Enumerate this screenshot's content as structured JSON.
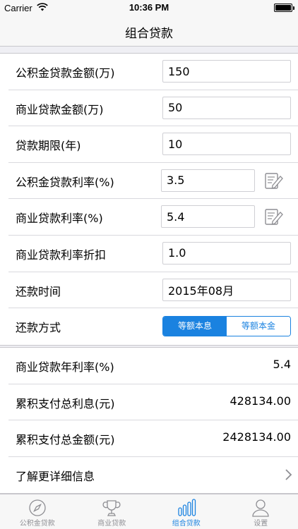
{
  "status_bar": {
    "carrier": "Carrier",
    "time": "10:36 PM"
  },
  "nav": {
    "title": "组合贷款"
  },
  "inputs": {
    "fund_amount": {
      "label": "公积金贷款金额(万)",
      "value": "150"
    },
    "commercial_amount": {
      "label": "商业贷款金额(万)",
      "value": "50"
    },
    "term": {
      "label": "贷款期限(年)",
      "value": "10"
    },
    "fund_rate": {
      "label": "公积金贷款利率(%)",
      "value": "3.5"
    },
    "commercial_rate": {
      "label": "商业贷款利率(%)",
      "value": "5.4"
    },
    "discount": {
      "label": "商业贷款利率折扣",
      "value": "1.0"
    },
    "start_date": {
      "label": "还款时间",
      "value": "2015年08月"
    },
    "method": {
      "label": "还款方式",
      "options": [
        "等额本息",
        "等额本金"
      ],
      "selected": "等额本息"
    }
  },
  "results": {
    "annual_rate": {
      "label": "商业贷款年利率(%)",
      "value": "5.4"
    },
    "total_interest": {
      "label": "累积支付总利息(元)",
      "value": "428134.00"
    },
    "total_payment": {
      "label": "累积支付总金额(元)",
      "value": "2428134.00"
    },
    "details": {
      "label": "了解更详细信息"
    }
  },
  "tabs": [
    {
      "label": "公积金贷款",
      "icon": "compass-icon",
      "active": false
    },
    {
      "label": "商业贷款",
      "icon": "trophy-icon",
      "active": false
    },
    {
      "label": "组合贷款",
      "icon": "bars-icon",
      "active": true
    },
    {
      "label": "设置",
      "icon": "person-icon",
      "active": false
    }
  ],
  "colors": {
    "accent": "#1a82e0",
    "inactive": "#8e8e93"
  }
}
